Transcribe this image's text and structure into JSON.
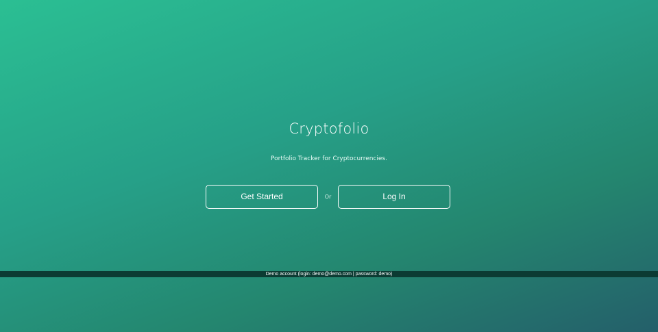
{
  "app": {
    "title": "Cryptofolio",
    "tagline": "Portfolio Tracker for Cryptocurrencies."
  },
  "actions": {
    "get_started_label": "Get Started",
    "separator_label": "Or",
    "login_label": "Log In"
  },
  "demo_notice": {
    "text": "Demo account (login: demo@demo.com | password: demo)"
  },
  "colors": {
    "gradient_start": "#2bbf93",
    "gradient_end": "#245f6a",
    "button_border": "#ffffff",
    "demo_bar_bg": "#0c3b33"
  }
}
